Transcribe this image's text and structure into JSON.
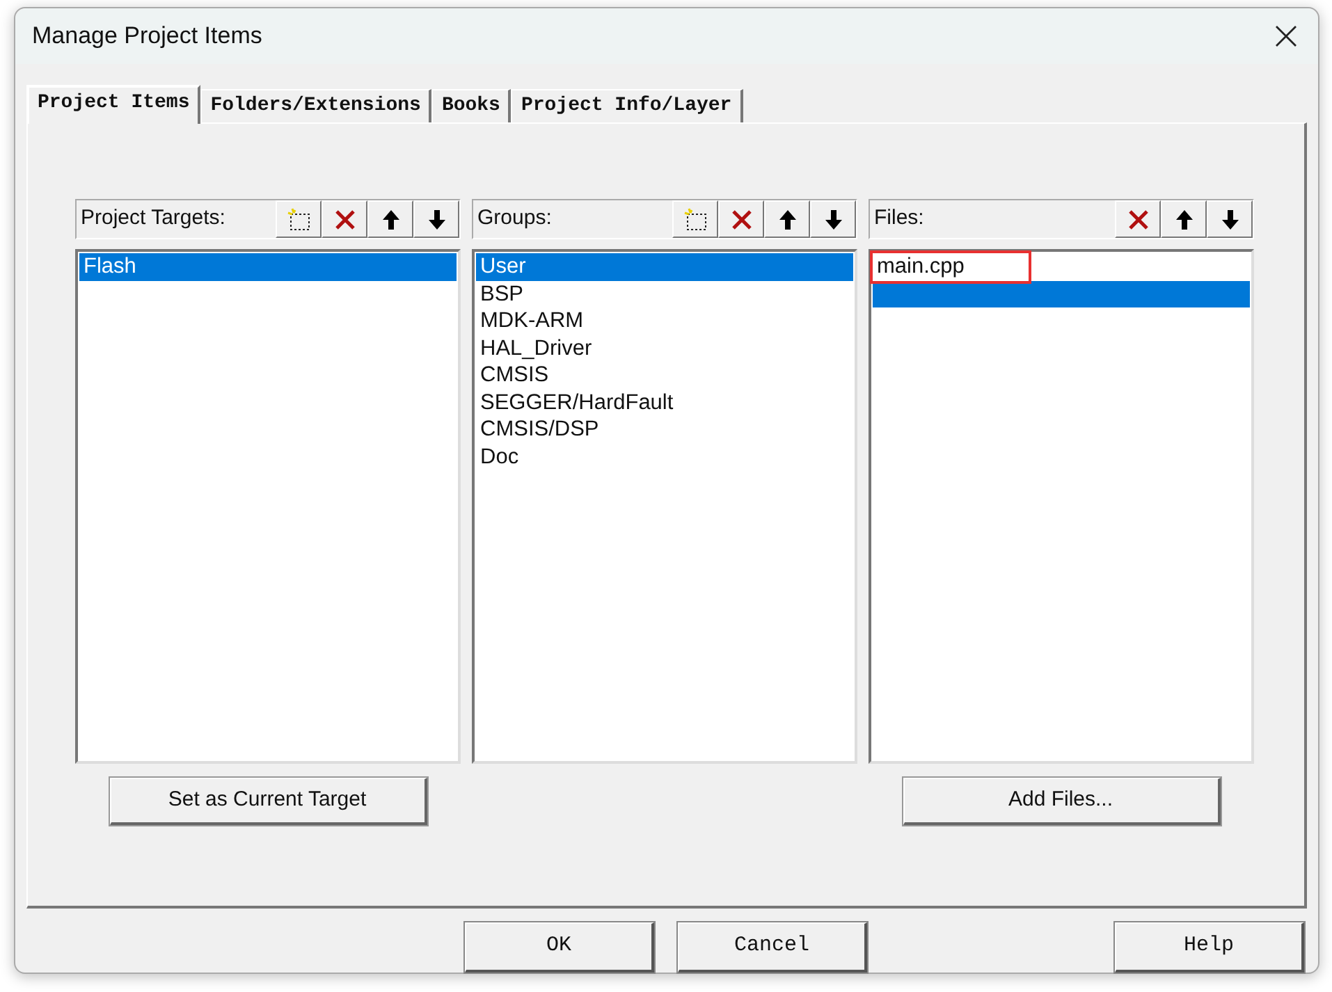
{
  "window": {
    "title": "Manage Project Items"
  },
  "tabs": [
    {
      "label": "Project Items",
      "selected": true
    },
    {
      "label": "Folders/Extensions",
      "selected": false
    },
    {
      "label": "Books",
      "selected": false
    },
    {
      "label": "Project Info/Layer",
      "selected": false
    }
  ],
  "panels": [
    {
      "label": "Project Targets:",
      "tools": [
        {
          "kind": "new"
        },
        {
          "kind": "delete"
        },
        {
          "kind": "up"
        },
        {
          "kind": "down"
        }
      ],
      "items": [
        {
          "name": "Flash",
          "selected": true
        }
      ],
      "button": "Set as Current Target"
    },
    {
      "label": "Groups:",
      "tools": [
        {
          "kind": "new"
        },
        {
          "kind": "delete"
        },
        {
          "kind": "up"
        },
        {
          "kind": "down"
        }
      ],
      "items": [
        {
          "name": "User",
          "selected": true
        },
        {
          "name": "BSP",
          "selected": false
        },
        {
          "name": "MDK-ARM",
          "selected": false
        },
        {
          "name": "HAL_Driver",
          "selected": false
        },
        {
          "name": "CMSIS",
          "selected": false
        },
        {
          "name": "SEGGER/HardFault",
          "selected": false
        },
        {
          "name": "CMSIS/DSP",
          "selected": false
        },
        {
          "name": "Doc",
          "selected": false
        }
      ]
    },
    {
      "label": "Files:",
      "tools": [
        {
          "kind": "delete"
        },
        {
          "kind": "up"
        },
        {
          "kind": "down"
        }
      ],
      "items": [
        {
          "name": "main.cpp",
          "selected": false,
          "highlighted": true
        },
        {
          "selected": true,
          "highlighted": false
        }
      ],
      "button": "Add Files..."
    }
  ],
  "buttons": [
    {
      "label": "OK",
      "kind": "main"
    },
    {
      "label": "Cancel",
      "kind": "main"
    },
    {
      "label": "Help",
      "kind": "aside"
    }
  ]
}
